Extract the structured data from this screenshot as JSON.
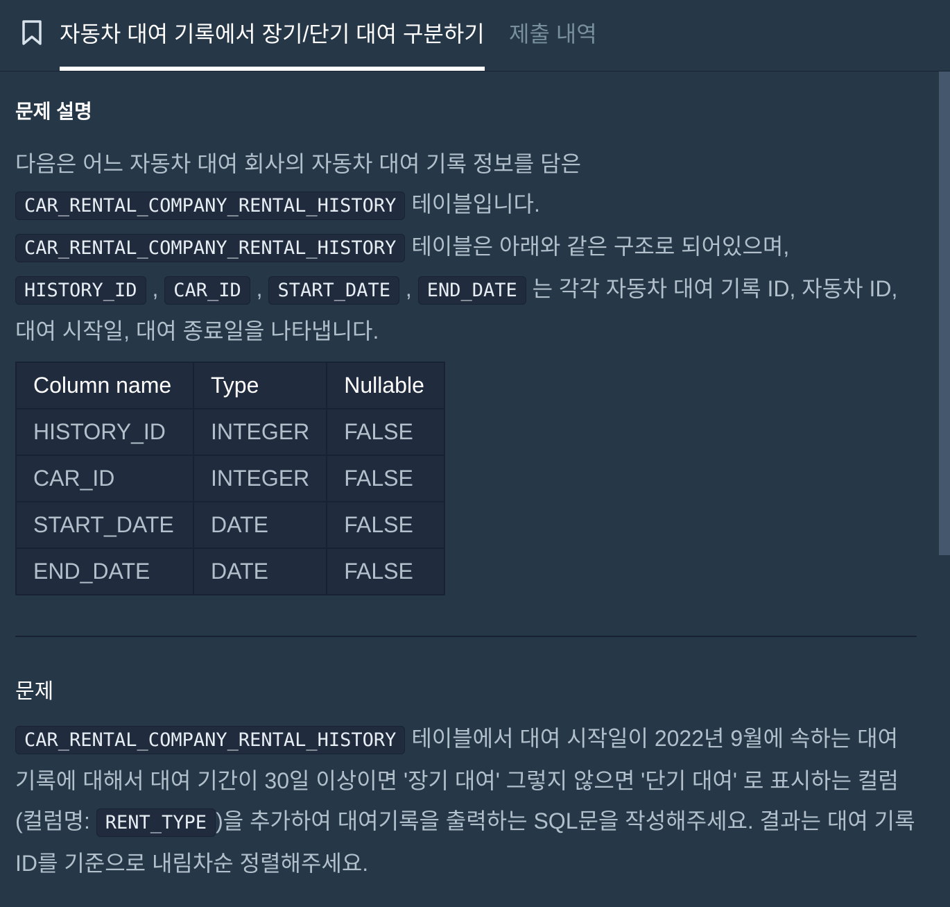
{
  "header": {
    "tab_active": "자동차 대여 기록에서 장기/단기 대여 구분하기",
    "tab_inactive": "제출 내역"
  },
  "description": {
    "title": "문제 설명",
    "line1": "다음은 어느 자동차 대여 회사의 자동차 대여 기록 정보를 담은",
    "table_name": "CAR_RENTAL_COMPANY_RENTAL_HISTORY",
    "line2_suffix": " 테이블입니다.",
    "line3_suffix": " 테이블은 아래와 같은 구조로 되어있으며,",
    "col_history_id": "HISTORY_ID",
    "col_car_id": "CAR_ID",
    "col_start_date": "START_DATE",
    "col_end_date": "END_DATE",
    "comma": ",",
    "line4_suffix": " 는 각각 자동차 대여 기록 ID, 자동차 ID,",
    "line5": "대여 시작일, 대여 종료일을 나타냅니다."
  },
  "schema_table": {
    "headers": [
      "Column name",
      "Type",
      "Nullable"
    ],
    "rows": [
      [
        "HISTORY_ID",
        "INTEGER",
        "FALSE"
      ],
      [
        "CAR_ID",
        "INTEGER",
        "FALSE"
      ],
      [
        "START_DATE",
        "DATE",
        "FALSE"
      ],
      [
        "END_DATE",
        "DATE",
        "FALSE"
      ]
    ]
  },
  "problem": {
    "title": "문제",
    "table_name": "CAR_RENTAL_COMPANY_RENTAL_HISTORY",
    "line1_suffix": " 테이블에서 대여 시작일이 2022년 9월에 속하는 대여",
    "line2": "기록에 대해서 대여 기간이 30일 이상이면 '장기 대여' 그렇지 않으면 '단기 대여' 로 표시하는 컬럼",
    "line3_prefix": "(컬럼명: ",
    "rent_type": "RENT_TYPE",
    "line3_suffix": ")을 추가하여 대여기록을 출력하는 SQL문을 작성해주세요. 결과는 대여 기록",
    "line4": "ID를 기준으로 내림차순 정렬해주세요."
  }
}
